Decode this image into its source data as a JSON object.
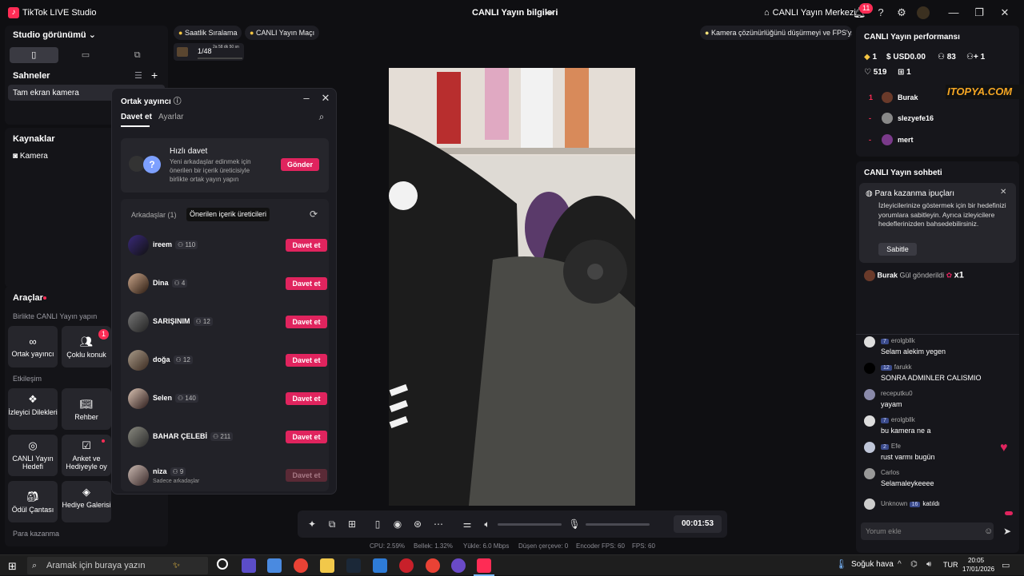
{
  "titlebar": {
    "app_title": "TikTok LIVE Studio",
    "center_title": "CANLI Yayın bilgileri",
    "live_center": "CANLI Yayın Merkezi",
    "notif_count": "11"
  },
  "sidebar": {
    "studio_view": "Studio görünümü",
    "scenes_title": "Sahneler",
    "scene_item": "Tam ekran kamera",
    "sources_title": "Kaynaklar",
    "source_item": "Kamera",
    "tools_title": "Araçlar",
    "group_live_together": "Birlikte CANLI Yayın yapın",
    "tool_cohost": "Ortak yayıncı",
    "tool_multi_guest": "Çoklu konuk",
    "multi_guest_badge": "1",
    "group_interaction": "Etkileşim",
    "tool_viewer_wishes": "İzleyici Dilekleri",
    "tool_guide": "Rehber",
    "tool_live_goal": "CANLI Yayın Hedefi",
    "tool_poll": "Anket ve Hediyeyle oy",
    "tool_reward_bag": "Ödül Çantası",
    "tool_gift_gallery": "Hediye Galerisi",
    "group_earn": "Para kazanma"
  },
  "top_chips": {
    "hourly_rank": "Saatlik Sıralama",
    "live_match": "CANLI Yayın Maçı",
    "warning": "Kamera çözünürlüğünü düşürmeyi ve FPS'y...",
    "goal_progress": "1/48",
    "goal_timer": "2a 58 dk 50 sn"
  },
  "dialog": {
    "title": "Ortak yayıncı",
    "tab_invite": "Davet et",
    "tab_settings": "Ayarlar",
    "quick_title": "Hızlı davet",
    "quick_desc": "Yeni arkadaşlar edinmek için önerilen bir içerik üreticisiyle birlikte ortak yayın yapın",
    "send_label": "Gönder",
    "friends_tab": "Arkadaşlar (1)",
    "suggested_tab": "Önerilen içerik üreticileri",
    "invite_label": "Davet et",
    "friends": [
      {
        "name": "ireem",
        "count": "110"
      },
      {
        "name": "Dina",
        "count": "4"
      },
      {
        "name": "SARIŞINIM",
        "count": "12"
      },
      {
        "name": "doğa",
        "count": "12"
      },
      {
        "name": "Selen",
        "count": "140"
      },
      {
        "name": "BAHAR ÇELEBİ",
        "count": "211"
      },
      {
        "name": "niza",
        "count": "9",
        "sub": "Sadece arkadaşlar"
      }
    ]
  },
  "right": {
    "perf_title": "CANLI Yayın performansı",
    "stat_diamond": "1",
    "stat_usd": "USD0.00",
    "stat_viewers": "83",
    "stat_follow": "1",
    "stat_likes": "519",
    "stat_gifts": "1",
    "ranking": [
      {
        "n": "1",
        "name": "Burak"
      },
      {
        "n": "-",
        "name": "slezyefe16"
      },
      {
        "n": "-",
        "name": "mert"
      }
    ],
    "chat_title": "CANLI Yayın sohbeti",
    "tip_title": "Para kazanma ipuçları",
    "tip_text": "İzleyicilerinize göstermek için bir hedefinizi yorumlara sabitleyin. Ayrıca izleyicilere hedeflerinizden bahsedebilirsiniz.",
    "tip_button": "Sabitle",
    "gift_user": "Burak",
    "gift_text": "Gül gönderildi",
    "gift_count": "x1",
    "messages": [
      {
        "level": "7",
        "user": "erolgbllk",
        "msg": "Selam alekim yegen"
      },
      {
        "level": "12",
        "user": "farukk",
        "msg": "SONRA ADMINLER CALISMIO"
      },
      {
        "level": "",
        "user": "receputku0",
        "msg": "yayam"
      },
      {
        "level": "7",
        "user": "erolgbllk",
        "msg": "bu kamera ne a"
      },
      {
        "level": "2",
        "user": "Efe",
        "msg": "rust varmı bugün"
      },
      {
        "level": "",
        "user": "Carlos",
        "msg": "Selamaleykeeee"
      }
    ],
    "join_user": "Unknown",
    "join_level": "16",
    "join_text": "katıldı",
    "comment_placeholder": "Yorum ekle",
    "watermark": "ITOPYA.COM"
  },
  "bottom": {
    "timer": "00:01:53",
    "cpu": "CPU: 2.59%",
    "memory": "Bellek: 1.32%",
    "upload": "Yükle: 6.0 Mbps",
    "dropped": "Düşen çerçeve: 0",
    "encoder_fps": "Encoder FPS: 60",
    "fps": "FPS: 60"
  },
  "taskbar": {
    "search_placeholder": "Aramak için buraya yazın",
    "weather": "Soğuk hava",
    "lang": "TUR",
    "time": "20:05",
    "date": "17/01/2026"
  }
}
